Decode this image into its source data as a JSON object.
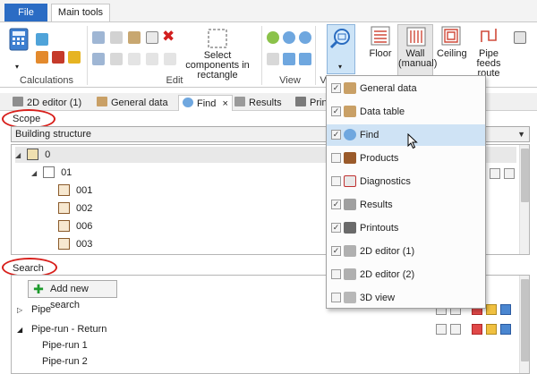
{
  "ribbon_tabs": {
    "file": "File",
    "main": "Main tools"
  },
  "ribbon": {
    "groups": {
      "calculations": "Calculations",
      "edit": "Edit",
      "view": "View",
      "view_cut": "V"
    },
    "select_components": "Select components in rectangle",
    "floor": "Floor",
    "wall": "Wall (manual)",
    "ceiling": "Ceiling",
    "pipe_feeds": "Pipe feeds route"
  },
  "doc_tabs": [
    {
      "label": "2D editor (1)"
    },
    {
      "label": "General data"
    },
    {
      "label": "Find",
      "close": "×"
    },
    {
      "label": "Results"
    },
    {
      "label": "Prin"
    }
  ],
  "scope": {
    "title": "Scope",
    "combo_value": "Building structure",
    "tree": [
      {
        "label": "0",
        "level": 0
      },
      {
        "label": "01",
        "level": 1
      },
      {
        "label": "001",
        "level": 2
      },
      {
        "label": "002",
        "level": 2
      },
      {
        "label": "006",
        "level": 2
      },
      {
        "label": "003",
        "level": 2
      }
    ]
  },
  "search": {
    "title": "Search",
    "add_button": "Add new search",
    "rows": [
      {
        "label": "Pipe",
        "level": 0
      },
      {
        "label": "Pipe-run - Return",
        "level": 0
      },
      {
        "label": "Pipe-run 1",
        "level": 1
      },
      {
        "label": "Pipe-run 2",
        "level": 1
      }
    ]
  },
  "dropdown": {
    "items": [
      {
        "label": "General data",
        "checked": true,
        "icon": "general-data-icon"
      },
      {
        "label": "Data table",
        "checked": true,
        "icon": "data-table-icon"
      },
      {
        "label": "Find",
        "checked": true,
        "icon": "find-icon"
      },
      {
        "label": "Products",
        "checked": false,
        "icon": "products-icon"
      },
      {
        "label": "Diagnostics",
        "checked": false,
        "icon": "diagnostics-icon"
      },
      {
        "label": "Results",
        "checked": true,
        "icon": "results-icon"
      },
      {
        "label": "Printouts",
        "checked": true,
        "icon": "printouts-icon"
      },
      {
        "label": "2D editor (1)",
        "checked": true,
        "icon": "2d-editor-icon"
      },
      {
        "label": "2D editor (2)",
        "checked": false,
        "icon": "2d-editor-icon"
      },
      {
        "label": "3D view",
        "checked": false,
        "icon": "3d-view-icon"
      }
    ],
    "highlighted_index": 2,
    "check_mark": "✓"
  }
}
